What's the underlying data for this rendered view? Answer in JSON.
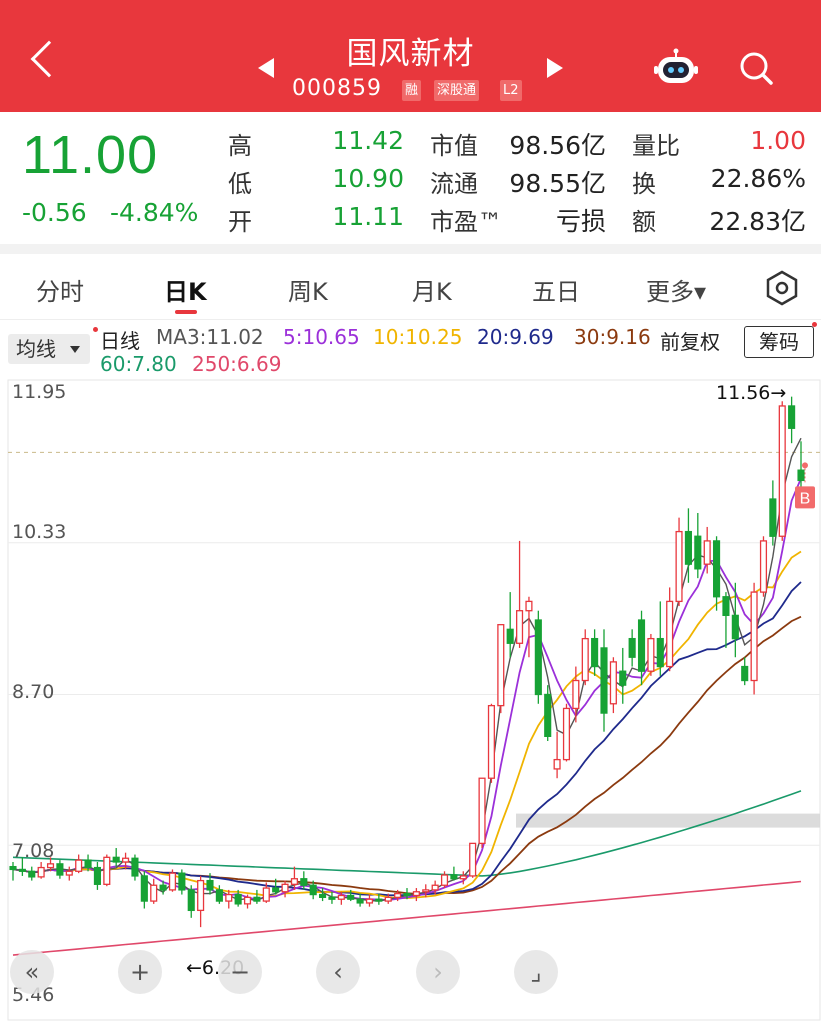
{
  "header": {
    "title": "国风新材",
    "code": "000859",
    "tags": [
      "融",
      "深股通",
      "L2"
    ]
  },
  "quote": {
    "price": "11.00",
    "change": "-0.56",
    "change_pct": "-4.84%",
    "stats": [
      {
        "label": "高",
        "value": "11.42",
        "color": "#17a235"
      },
      {
        "label": "低",
        "value": "10.90",
        "color": "#17a235"
      },
      {
        "label": "开",
        "value": "11.11",
        "color": "#17a235"
      },
      {
        "label": "市值",
        "value": "98.56亿",
        "color": "#222222"
      },
      {
        "label": "流通",
        "value": "98.55亿",
        "color": "#222222"
      },
      {
        "label": "市盈™",
        "value": "亏损",
        "color": "#222222"
      },
      {
        "label": "量比",
        "value": "1.00",
        "color": "#e8373d"
      },
      {
        "label": "换",
        "value": "22.86%",
        "color": "#222222"
      },
      {
        "label": "额",
        "value": "22.83亿",
        "color": "#222222"
      }
    ]
  },
  "tabs": [
    "分时",
    "日K",
    "周K",
    "月K",
    "五日",
    "更多▾"
  ],
  "active_tab": "日K",
  "ma": {
    "selector": "均线",
    "period": "日线",
    "items": [
      {
        "label": "MA3:11.02",
        "color": "#555555"
      },
      {
        "label": "5:10.65",
        "color": "#9b30d9"
      },
      {
        "label": "10:10.25",
        "color": "#f0b400"
      },
      {
        "label": "20:9.69",
        "color": "#1f2a8c"
      },
      {
        "label": "30:9.16",
        "color": "#8b3a0f"
      },
      {
        "label": "60:7.80",
        "color": "#1a9a6a"
      },
      {
        "label": "250:6.69",
        "color": "#e0486a"
      }
    ],
    "adjust": "前复权",
    "chips": "筹码"
  },
  "chart_data": {
    "type": "candlestick",
    "y_ticks": [
      "11.95",
      "10.33",
      "8.70",
      "7.08",
      "5.46"
    ],
    "ylim": [
      5.46,
      11.95
    ],
    "max_label": "11.56→",
    "min_label": "←6.20",
    "current_price": 11.0,
    "ma_final": {
      "ma3": 11.02,
      "ma5": 10.65,
      "ma10": 10.25,
      "ma20": 9.69,
      "ma30": 9.16,
      "ma60": 7.8,
      "ma250": 6.69
    },
    "candles": [
      [
        6.85,
        6.9,
        6.7,
        6.82
      ],
      [
        6.82,
        6.95,
        6.75,
        6.8
      ],
      [
        6.8,
        6.85,
        6.7,
        6.74
      ],
      [
        6.74,
        6.9,
        6.72,
        6.84
      ],
      [
        6.84,
        6.95,
        6.8,
        6.88
      ],
      [
        6.88,
        6.92,
        6.72,
        6.76
      ],
      [
        6.76,
        6.85,
        6.7,
        6.8
      ],
      [
        6.8,
        6.98,
        6.78,
        6.92
      ],
      [
        6.92,
        6.98,
        6.8,
        6.84
      ],
      [
        6.84,
        6.9,
        6.6,
        6.66
      ],
      [
        6.66,
        6.98,
        6.64,
        6.95
      ],
      [
        6.95,
        7.05,
        6.85,
        6.9
      ],
      [
        6.9,
        7.0,
        6.82,
        6.94
      ],
      [
        6.94,
        6.98,
        6.7,
        6.75
      ],
      [
        6.75,
        6.8,
        6.4,
        6.48
      ],
      [
        6.48,
        6.72,
        6.45,
        6.65
      ],
      [
        6.65,
        6.7,
        6.55,
        6.6
      ],
      [
        6.6,
        6.82,
        6.58,
        6.78
      ],
      [
        6.78,
        6.82,
        6.55,
        6.6
      ],
      [
        6.6,
        6.65,
        6.3,
        6.38
      ],
      [
        6.38,
        6.75,
        6.2,
        6.7
      ],
      [
        6.7,
        6.78,
        6.55,
        6.6
      ],
      [
        6.6,
        6.65,
        6.45,
        6.48
      ],
      [
        6.48,
        6.6,
        6.4,
        6.55
      ],
      [
        6.55,
        6.6,
        6.42,
        6.45
      ],
      [
        6.45,
        6.55,
        6.4,
        6.52
      ],
      [
        6.52,
        6.6,
        6.45,
        6.48
      ],
      [
        6.48,
        6.68,
        6.46,
        6.62
      ],
      [
        6.62,
        6.72,
        6.55,
        6.58
      ],
      [
        6.58,
        6.7,
        6.52,
        6.66
      ],
      [
        6.66,
        6.85,
        6.6,
        6.72
      ],
      [
        6.72,
        6.8,
        6.6,
        6.65
      ],
      [
        6.65,
        6.7,
        6.5,
        6.55
      ],
      [
        6.55,
        6.62,
        6.48,
        6.52
      ],
      [
        6.52,
        6.58,
        6.45,
        6.5
      ],
      [
        6.5,
        6.58,
        6.44,
        6.54
      ],
      [
        6.54,
        6.6,
        6.48,
        6.5
      ],
      [
        6.5,
        6.56,
        6.42,
        6.46
      ],
      [
        6.46,
        6.55,
        6.42,
        6.5
      ],
      [
        6.5,
        6.56,
        6.44,
        6.48
      ],
      [
        6.48,
        6.56,
        6.45,
        6.52
      ],
      [
        6.52,
        6.6,
        6.48,
        6.56
      ],
      [
        6.56,
        6.62,
        6.5,
        6.54
      ],
      [
        6.54,
        6.62,
        6.48,
        6.58
      ],
      [
        6.58,
        6.66,
        6.52,
        6.6
      ],
      [
        6.6,
        6.7,
        6.55,
        6.65
      ],
      [
        6.65,
        6.8,
        6.62,
        6.76
      ],
      [
        6.76,
        6.85,
        6.7,
        6.72
      ],
      [
        6.72,
        6.8,
        6.66,
        6.75
      ],
      [
        6.75,
        7.1,
        6.73,
        7.1
      ],
      [
        7.1,
        7.8,
        7.05,
        7.8
      ],
      [
        7.8,
        8.6,
        7.75,
        8.58
      ],
      [
        8.58,
        9.45,
        8.5,
        9.45
      ],
      [
        9.4,
        9.8,
        9.1,
        9.25
      ],
      [
        9.25,
        10.35,
        9.2,
        9.6
      ],
      [
        9.6,
        9.75,
        9.1,
        9.7
      ],
      [
        9.5,
        9.6,
        8.6,
        8.7
      ],
      [
        8.7,
        8.8,
        8.2,
        8.25
      ],
      [
        7.9,
        8.3,
        7.8,
        8.0
      ],
      [
        8.0,
        8.6,
        7.98,
        8.55
      ],
      [
        8.55,
        9.0,
        8.4,
        8.85
      ],
      [
        8.85,
        9.4,
        8.8,
        9.3
      ],
      [
        9.3,
        9.4,
        8.9,
        9.0
      ],
      [
        9.2,
        9.4,
        8.3,
        8.5
      ],
      [
        8.6,
        9.1,
        8.5,
        9.05
      ],
      [
        8.95,
        9.2,
        8.6,
        8.8
      ],
      [
        9.3,
        9.4,
        9.0,
        9.1
      ],
      [
        9.5,
        9.6,
        8.8,
        8.95
      ],
      [
        8.95,
        9.35,
        8.9,
        9.3
      ],
      [
        9.3,
        9.7,
        8.9,
        9.0
      ],
      [
        9.0,
        9.85,
        8.95,
        9.7
      ],
      [
        9.7,
        10.6,
        9.65,
        10.45
      ],
      [
        10.45,
        10.7,
        9.9,
        10.1
      ],
      [
        10.4,
        10.65,
        9.95,
        10.05
      ],
      [
        10.1,
        10.5,
        10.0,
        10.35
      ],
      [
        10.35,
        10.4,
        9.6,
        9.75
      ],
      [
        9.75,
        9.8,
        9.2,
        9.55
      ],
      [
        9.55,
        9.9,
        9.1,
        9.3
      ],
      [
        9.0,
        9.1,
        8.8,
        8.85
      ],
      [
        8.85,
        9.9,
        8.7,
        9.8
      ],
      [
        9.8,
        10.4,
        9.75,
        10.35
      ],
      [
        10.8,
        11.0,
        10.3,
        10.4
      ],
      [
        10.4,
        11.85,
        10.35,
        11.8
      ],
      [
        11.8,
        11.9,
        11.4,
        11.56
      ],
      [
        11.11,
        11.42,
        10.9,
        11.0
      ]
    ]
  },
  "controls": [
    "«",
    "+",
    "−",
    "‹",
    "›",
    "⌟"
  ]
}
